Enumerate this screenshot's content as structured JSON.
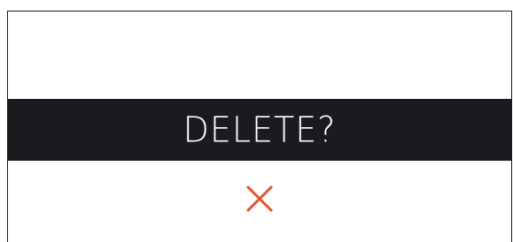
{
  "dialog": {
    "prompt": "DELETE?",
    "cancel_icon": "close-icon",
    "colors": {
      "banner_background": "#1c1a1e",
      "banner_text": "#ffffff",
      "accent": "#e8502b",
      "background": "#ffffff"
    }
  }
}
